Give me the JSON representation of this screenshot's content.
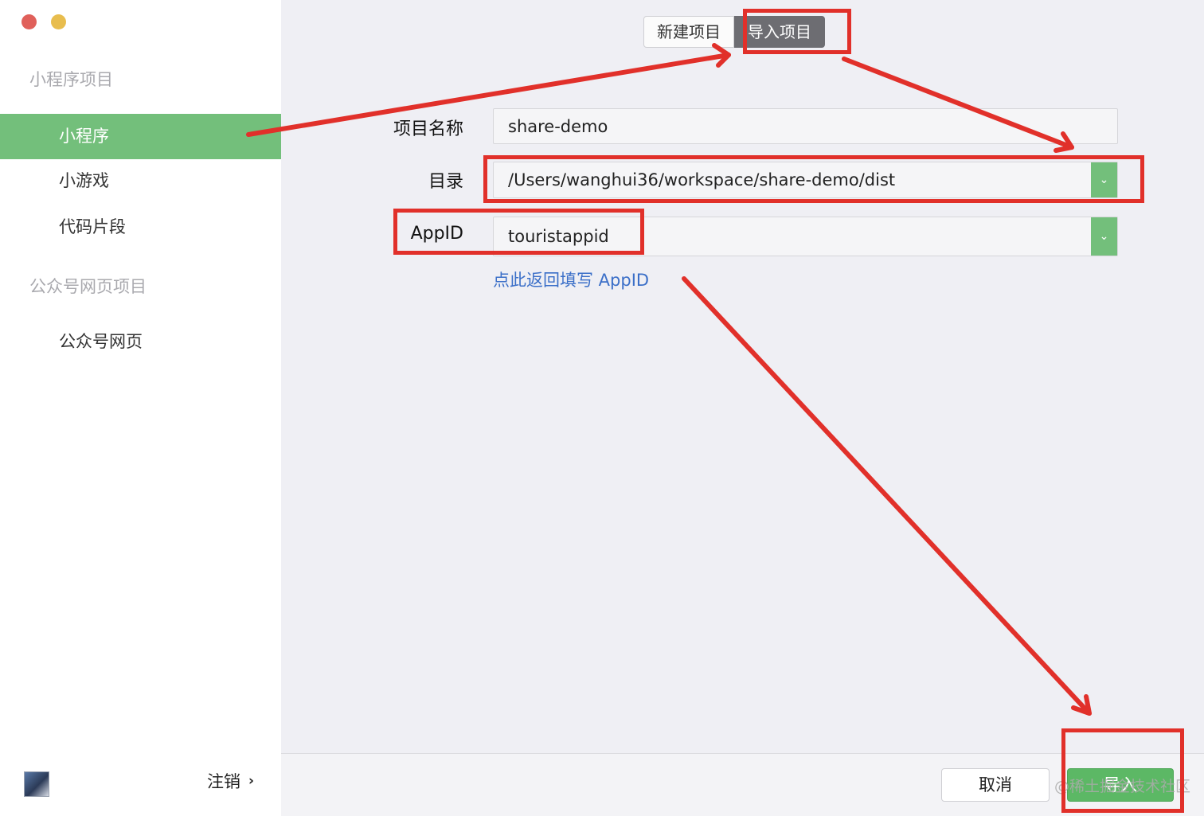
{
  "sidebar": {
    "sections": [
      {
        "title": "小程序项目",
        "items": [
          "小程序",
          "小游戏",
          "代码片段"
        ]
      },
      {
        "title": "公众号网页项目",
        "items": [
          "公众号网页"
        ]
      }
    ],
    "active_item": "小程序",
    "logout_label": "注销"
  },
  "tabs": [
    {
      "label": "新建项目",
      "active": false
    },
    {
      "label": "导入项目",
      "active": true
    }
  ],
  "form": {
    "project_name": {
      "label": "项目名称",
      "value": "share-demo"
    },
    "directory": {
      "label": "目录",
      "value": "/Users/wanghui36/workspace/share-demo/dist"
    },
    "appid": {
      "label": "AppID",
      "value": "touristappid"
    },
    "appid_link": "点此返回填写 AppID"
  },
  "footer": {
    "cancel_label": "取消",
    "confirm_label": "导入"
  },
  "watermark": "@稀土掘金技术社区",
  "colors": {
    "accent_green": "#73bf7b",
    "annotation_red": "#e1302a",
    "link_blue": "#3b6fc8"
  }
}
